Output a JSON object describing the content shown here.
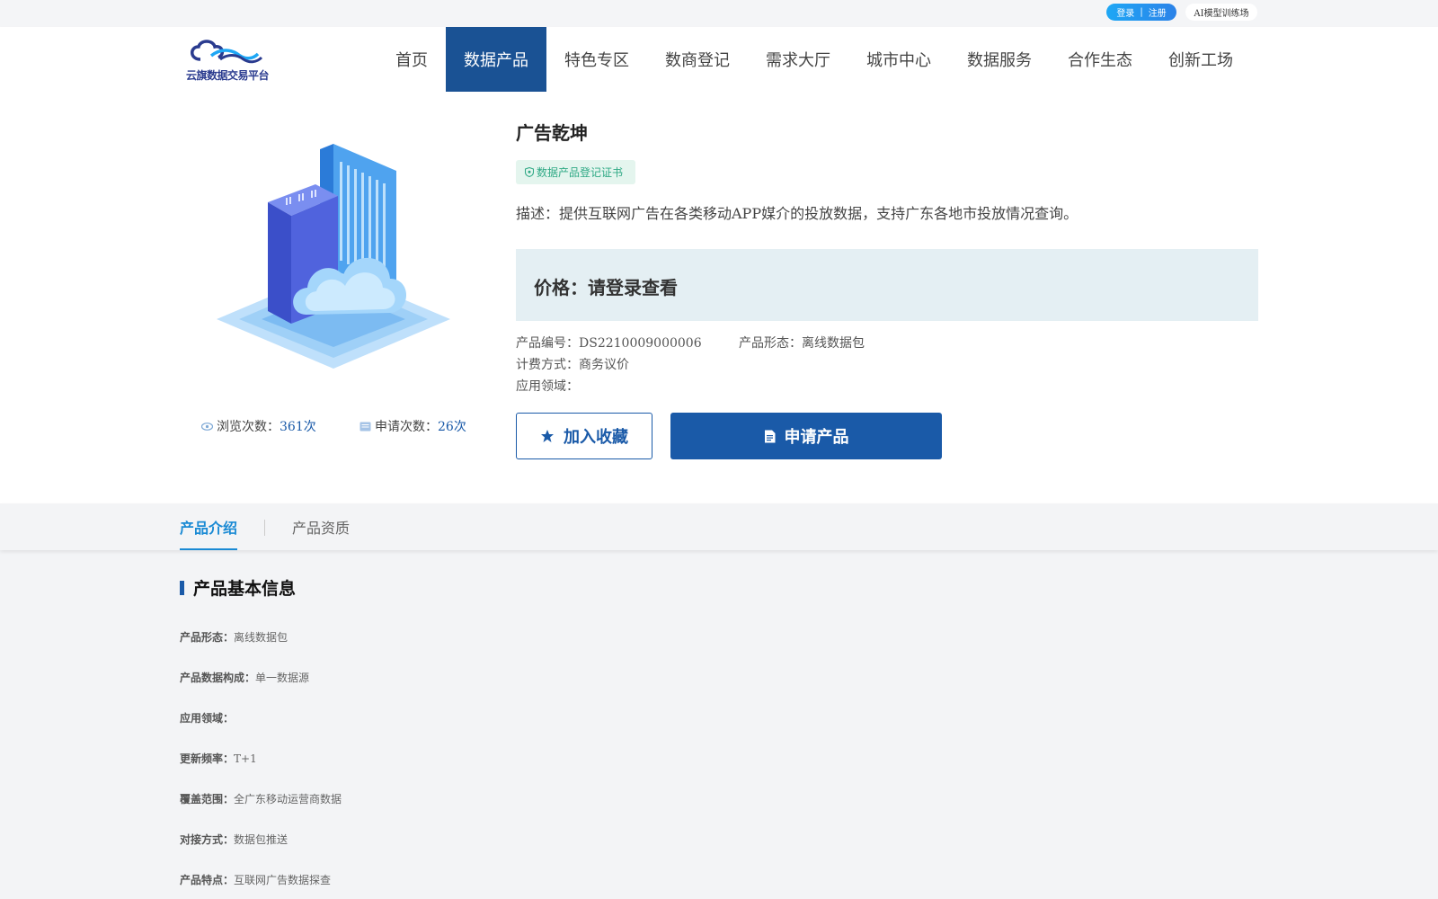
{
  "topbar": {
    "login": "登录",
    "divider": "|",
    "register": "注册",
    "ai_link": "AI模型训练场"
  },
  "logo": {
    "text": "云旗数据交易平台"
  },
  "nav": {
    "items": [
      "首页",
      "数据产品",
      "特色专区",
      "数商登记",
      "需求大厅",
      "城市中心",
      "数据服务",
      "合作生态",
      "创新工场"
    ],
    "active": "数据产品"
  },
  "product": {
    "title": "广告乾坤",
    "cert_badge": "数据产品登记证书",
    "description": "描述：提供互联网广告在各类移动APP媒介的投放数据，支持广东各地市投放情况查询。",
    "price": "价格：请登录查看",
    "code_label": "产品编号：",
    "code_value": "DS2210009000006",
    "form_label": "产品形态：",
    "form_value": "离线数据包",
    "billing_label": "计费方式：",
    "billing_value": "商务议价",
    "domain_label": "应用领域：",
    "domain_value": "",
    "views_label": "浏览次数：",
    "views_value": "361次",
    "apply_label": "申请次数：",
    "apply_value": "26次",
    "fav_button": "加入收藏",
    "apply_button": "申请产品"
  },
  "tabs": {
    "intro": "产品介绍",
    "qualification": "产品资质"
  },
  "basic_info": {
    "title": "产品基本信息",
    "rows": [
      {
        "label": "产品形态：",
        "value": "离线数据包"
      },
      {
        "label": "产品数据构成：",
        "value": "单一数据源"
      },
      {
        "label": "应用领域：",
        "value": ""
      },
      {
        "label": "更新频率：",
        "value": "T+1"
      },
      {
        "label": "覆盖范围：",
        "value": "全广东移动运营商数据"
      },
      {
        "label": "对接方式：",
        "value": "数据包推送"
      },
      {
        "label": "产品特点：",
        "value": "互联网广告数据探查"
      }
    ]
  },
  "colors": {
    "nav_active": "#1a5294",
    "primary": "#1a5aa8",
    "tab_active": "#1a8ad4",
    "cert_bg": "#e4f5ee",
    "cert_text": "#2fa985",
    "price_bg": "#e4eff3"
  }
}
